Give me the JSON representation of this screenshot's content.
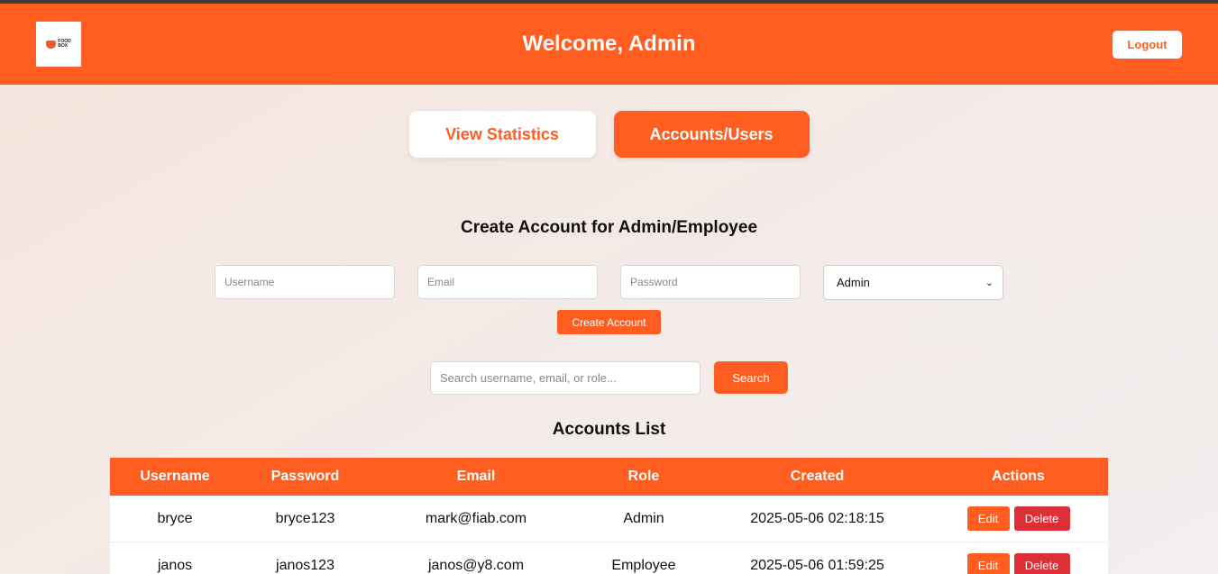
{
  "header": {
    "title": "Welcome, Admin",
    "logout_label": "Logout",
    "logo_text_line1": "FOOD",
    "logo_text_line2": "BOX"
  },
  "tabs": [
    {
      "label": "View Statistics",
      "active": false
    },
    {
      "label": "Accounts/Users",
      "active": true
    }
  ],
  "create_form": {
    "title": "Create Account for Admin/Employee",
    "username_placeholder": "Username",
    "email_placeholder": "Email",
    "password_placeholder": "Password",
    "role_selected": "Admin",
    "submit_label": "Create Account"
  },
  "search": {
    "placeholder": "Search username, email, or role...",
    "button_label": "Search"
  },
  "accounts": {
    "title": "Accounts List",
    "columns": [
      "Username",
      "Password",
      "Email",
      "Role",
      "Created",
      "Actions"
    ],
    "rows": [
      {
        "username": "bryce",
        "password": "bryce123",
        "email": "mark@fiab.com",
        "role": "Admin",
        "created": "2025-05-06 02:18:15"
      },
      {
        "username": "janos",
        "password": "janos123",
        "email": "janos@y8.com",
        "role": "Employee",
        "created": "2025-05-06 01:59:25"
      }
    ],
    "edit_label": "Edit",
    "delete_label": "Delete"
  },
  "colors": {
    "accent": "#ff5e20",
    "danger": "#dc2f36"
  }
}
